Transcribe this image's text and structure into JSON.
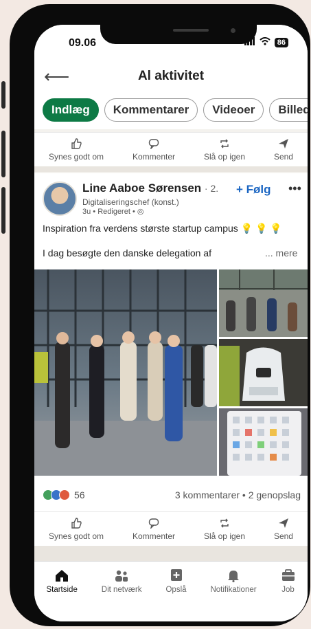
{
  "status_bar": {
    "time": "09.06",
    "battery": "86"
  },
  "header": {
    "title": "Al aktivitet"
  },
  "tabs": [
    {
      "label": "Indlæg",
      "active": true
    },
    {
      "label": "Kommentarer",
      "active": false
    },
    {
      "label": "Videoer",
      "active": false
    },
    {
      "label": "Billeder",
      "active": false
    }
  ],
  "actions": [
    {
      "label": "Synes godt om",
      "icon": "thumbs-up-icon"
    },
    {
      "label": "Kommenter",
      "icon": "comment-icon"
    },
    {
      "label": "Slå op igen",
      "icon": "repost-icon"
    },
    {
      "label": "Send",
      "icon": "send-icon"
    }
  ],
  "post": {
    "author": "Line Aaboe Sørensen",
    "degree": "· 2.",
    "subtitle": "Digitaliseringschef (konst.)",
    "meta": "3u • Redigeret • ◎",
    "follow_label": "+ Følg",
    "text_line1": "Inspiration fra verdens største startup campus 💡 💡 💡",
    "text_line2": "I dag besøgte den danske delegation af",
    "more_label": "... mere",
    "reactions_count": "56",
    "comments_reposts": "3 kommentarer • 2 genopslag"
  },
  "bottom_nav": [
    {
      "label": "Startside",
      "icon": "home-icon",
      "active": true
    },
    {
      "label": "Dit netværk",
      "icon": "network-icon",
      "active": false
    },
    {
      "label": "Opslå",
      "icon": "post-icon",
      "active": false
    },
    {
      "label": "Notifikationer",
      "icon": "bell-icon",
      "active": false
    },
    {
      "label": "Job",
      "icon": "briefcase-icon",
      "active": false
    }
  ],
  "colors": {
    "accent_green": "#0d7a45",
    "link_blue": "#1a65c2"
  }
}
